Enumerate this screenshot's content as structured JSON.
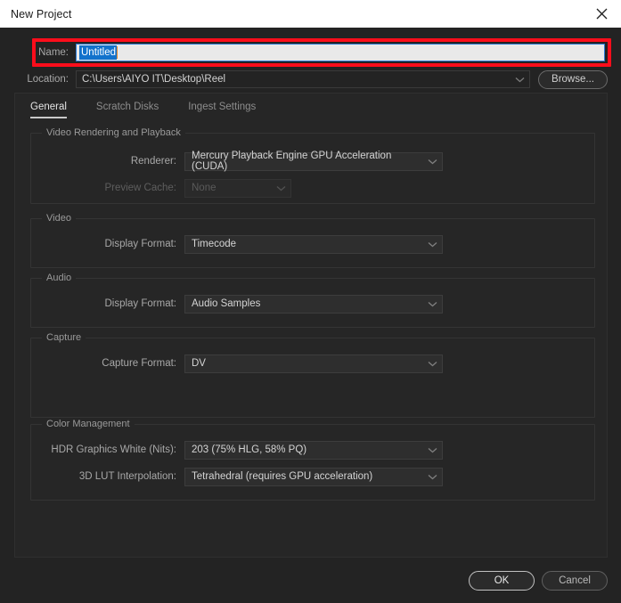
{
  "window": {
    "title": "New Project",
    "close_icon": "close-icon"
  },
  "fields": {
    "name_label": "Name:",
    "name_value": "Untitled",
    "location_label": "Location:",
    "location_value": "C:\\Users\\AIYO IT\\Desktop\\Reel",
    "browse_label": "Browse..."
  },
  "annotation": {
    "highlight_color": "#fc0d1b"
  },
  "tabs": [
    {
      "label": "General",
      "active": true
    },
    {
      "label": "Scratch Disks",
      "active": false
    },
    {
      "label": "Ingest Settings",
      "active": false
    }
  ],
  "sections": {
    "video_rendering": {
      "legend": "Video Rendering and Playback",
      "renderer_label": "Renderer:",
      "renderer_value": "Mercury Playback Engine GPU Acceleration (CUDA)",
      "preview_cache_label": "Preview Cache:",
      "preview_cache_value": "None"
    },
    "video": {
      "legend": "Video",
      "display_format_label": "Display Format:",
      "display_format_value": "Timecode"
    },
    "audio": {
      "legend": "Audio",
      "display_format_label": "Display Format:",
      "display_format_value": "Audio Samples"
    },
    "capture": {
      "legend": "Capture",
      "capture_format_label": "Capture Format:",
      "capture_format_value": "DV"
    },
    "color_management": {
      "legend": "Color Management",
      "hdr_label": "HDR Graphics White (Nits):",
      "hdr_value": "203 (75% HLG, 58% PQ)",
      "lut_label": "3D LUT Interpolation:",
      "lut_value": "Tetrahedral (requires GPU acceleration)"
    }
  },
  "footer": {
    "ok_label": "OK",
    "cancel_label": "Cancel"
  }
}
